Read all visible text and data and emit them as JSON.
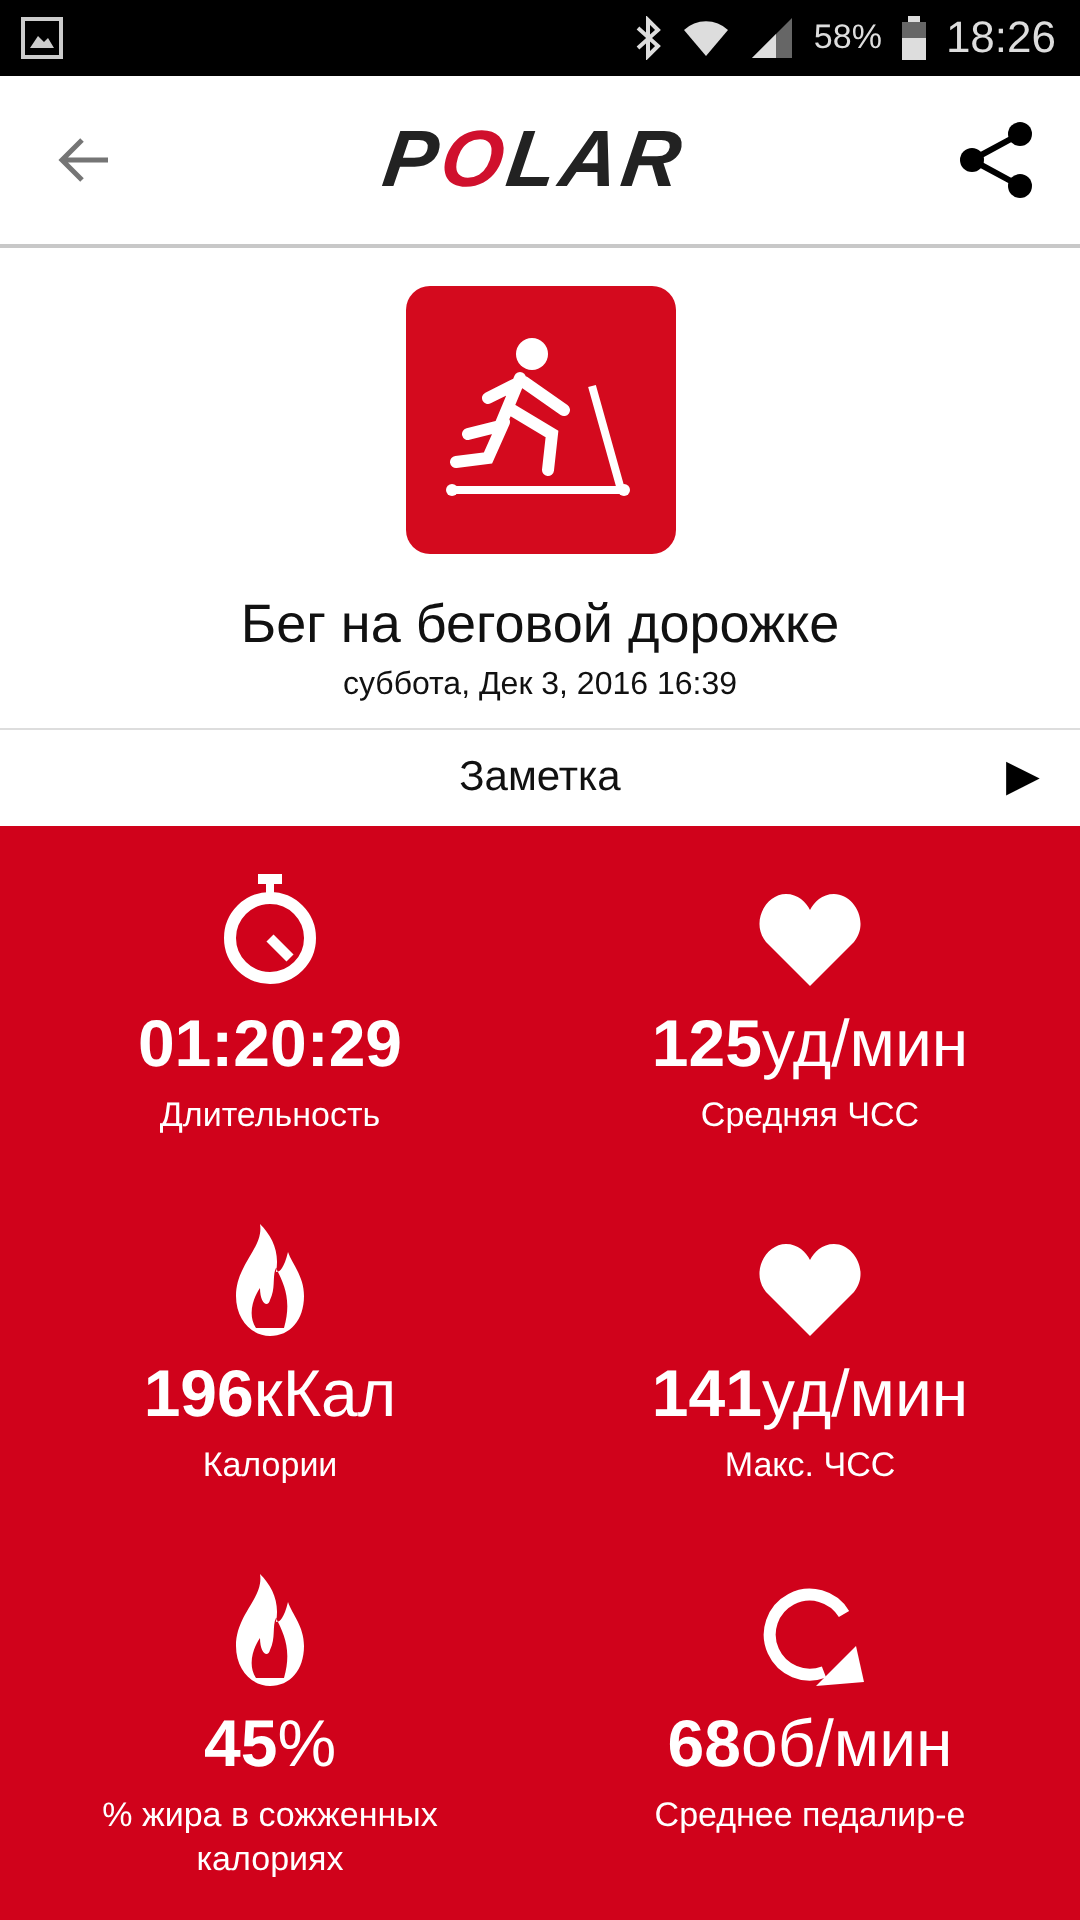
{
  "status_bar": {
    "battery_text": "58%",
    "time": "18:26"
  },
  "header": {
    "logo": "POLAR"
  },
  "activity": {
    "title": "Бег на беговой дорожке",
    "date": "суббота, Дек 3, 2016 16:39"
  },
  "note": {
    "label": "Заметка",
    "arrow": "▶"
  },
  "stats": [
    {
      "kind": "stopwatch",
      "value": "**01:20:29**",
      "label": "Длительность"
    },
    {
      "kind": "heart",
      "value": "**125**уд/мин",
      "label": "Средняя ЧСС"
    },
    {
      "kind": "flame",
      "value": "**196**кКал",
      "label": "Калории"
    },
    {
      "kind": "heart",
      "value": "**141**уд/мин",
      "label": "Макс. ЧСС"
    },
    {
      "kind": "flame",
      "value": "**45**%",
      "label": "% жира в сожженных калориях"
    },
    {
      "kind": "cycle",
      "value": "**68**об/мин",
      "label": "Среднее педалир-е"
    }
  ]
}
